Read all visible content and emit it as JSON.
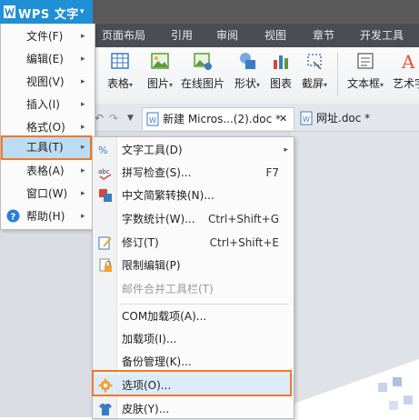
{
  "app": {
    "brand": "WPS 文字",
    "brand_caret": "▾"
  },
  "ribbon_tabs": [
    "页面布局",
    "引用",
    "审阅",
    "视图",
    "章节",
    "开发工具"
  ],
  "ribbon": {
    "buttons": [
      {
        "label": "表格",
        "icon": "table-icon",
        "caret": "▾"
      },
      {
        "label": "图片",
        "icon": "picture-icon",
        "caret": "▾"
      },
      {
        "label": "在线图片",
        "icon": "online-picture-icon",
        "caret": ""
      },
      {
        "label": "形状",
        "icon": "shape-icon",
        "caret": "▾"
      },
      {
        "label": "图表",
        "icon": "chart-icon",
        "caret": ""
      },
      {
        "label": "截屏",
        "icon": "screenshot-icon",
        "caret": "▾"
      },
      {
        "label": "文本框",
        "icon": "textbox-icon",
        "caret": "▾"
      },
      {
        "label": "艺术字",
        "icon": "wordart-icon",
        "caret": ""
      }
    ]
  },
  "doc_tabs": [
    {
      "label": "新建 Micros...(2).doc *",
      "close": "✕"
    },
    {
      "label": "网址.doc *",
      "close": ""
    }
  ],
  "main_menu": [
    {
      "label": "文件(F)",
      "arrow": "▸"
    },
    {
      "label": "编辑(E)",
      "arrow": "▸"
    },
    {
      "label": "视图(V)",
      "arrow": "▸"
    },
    {
      "label": "插入(I)",
      "arrow": "▸"
    },
    {
      "label": "格式(O)",
      "arrow": "▸"
    },
    {
      "label": "工具(T)",
      "arrow": "▸"
    },
    {
      "label": "表格(A)",
      "arrow": "▸"
    },
    {
      "label": "窗口(W)",
      "arrow": "▸"
    },
    {
      "label": "帮助(H)",
      "arrow": "▸"
    }
  ],
  "tools_submenu": [
    {
      "label": "文字工具(D)",
      "shortcut": "",
      "arrow": "▸",
      "icon": "text-tools-icon",
      "disabled": false
    },
    {
      "label": "拼写检查(S)...",
      "shortcut": "F7",
      "arrow": "",
      "icon": "spellcheck-icon",
      "disabled": false
    },
    {
      "label": "中文简繁转换(N)...",
      "shortcut": "",
      "arrow": "",
      "icon": "convert-icon",
      "disabled": false
    },
    {
      "label": "字数统计(W)...",
      "shortcut": "Ctrl+Shift+G",
      "arrow": "",
      "icon": "",
      "disabled": false
    },
    {
      "label": "修订(T)",
      "shortcut": "Ctrl+Shift+E",
      "arrow": "",
      "icon": "revision-icon",
      "disabled": false
    },
    {
      "label": "限制编辑(P)",
      "shortcut": "",
      "arrow": "",
      "icon": "lock-icon",
      "disabled": false
    },
    {
      "label": "邮件合并工具栏(T)",
      "shortcut": "",
      "arrow": "",
      "icon": "",
      "disabled": true
    },
    {
      "label": "COM加载项(A)...",
      "shortcut": "",
      "arrow": "",
      "icon": "",
      "disabled": false
    },
    {
      "label": "加载项(I)...",
      "shortcut": "",
      "arrow": "",
      "icon": "",
      "disabled": false
    },
    {
      "label": "备份管理(K)...",
      "shortcut": "",
      "arrow": "",
      "icon": "",
      "disabled": false
    },
    {
      "label": "选项(O)...",
      "shortcut": "",
      "arrow": "",
      "icon": "gear-icon",
      "disabled": false
    },
    {
      "label": "皮肤(Y)...",
      "shortcut": "",
      "arrow": "",
      "icon": "skin-icon",
      "disabled": false
    }
  ],
  "colors": {
    "brand_blue": "#1f8fd6",
    "highlight_orange": "#f0782a",
    "menu_active": "#bcdcf4"
  }
}
